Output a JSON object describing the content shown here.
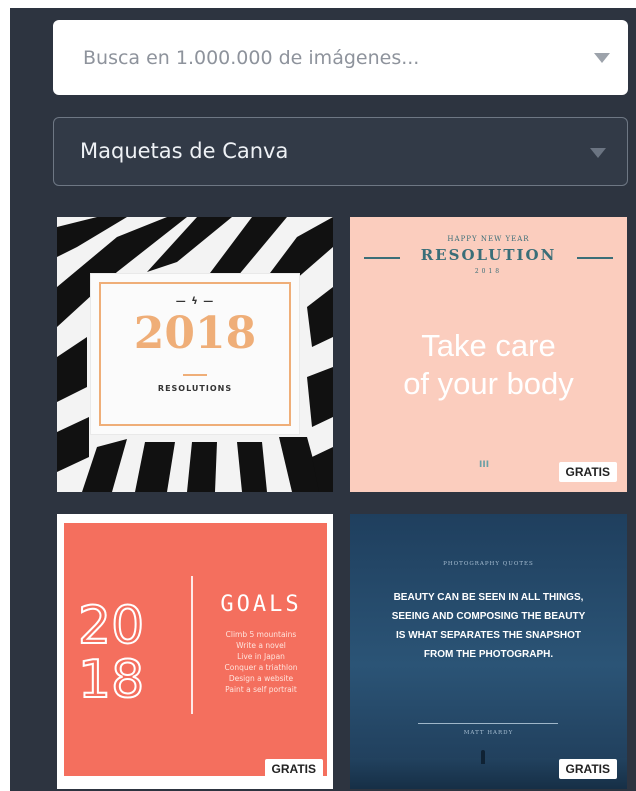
{
  "search": {
    "placeholder": "Busca en 1.000.000 de imágenes..."
  },
  "source_select": {
    "selected": "Maquetas de Canva"
  },
  "templates": [
    {
      "name": "2018 Resolutions",
      "deco": "— ϟ —",
      "year": "2018",
      "subtitle": "RESOLUTIONS"
    },
    {
      "name": "Resolution",
      "top": "HAPPY NEW YEAR",
      "title": "RESOLUTION",
      "year": "2018",
      "body": [
        "Take care",
        "of your body"
      ],
      "signature": "III",
      "badge": "GRATIS"
    },
    {
      "name": "2018 Goals",
      "year_top": "20",
      "year_bottom": "18",
      "title": "GOALS",
      "items": [
        "Climb 5 mountains",
        "Write a novel",
        "Live in Japan",
        "Conquer a triathlon",
        "Design a website",
        "Paint a self portrait"
      ],
      "badge": "GRATIS"
    },
    {
      "name": "Photography Quote",
      "subtitle": "PHOTOGRAPHY QUOTES",
      "quote": "BEAUTY CAN BE SEEN IN ALL THINGS, SEEING AND COMPOSING THE BEAUTY IS WHAT SEPARATES THE SNAPSHOT FROM THE PHOTOGRAPH.",
      "author": "MATT HARDY",
      "badge": "GRATIS"
    }
  ],
  "colors": {
    "panel": "#2d3440",
    "orange_accent": "#efae78",
    "peach": "#fbcdbe",
    "teal_text": "#3a6e78",
    "coral": "#f46f5e",
    "navy": "#1f3f5e"
  },
  "icons": {
    "dropdown": "chevron-down-icon"
  }
}
